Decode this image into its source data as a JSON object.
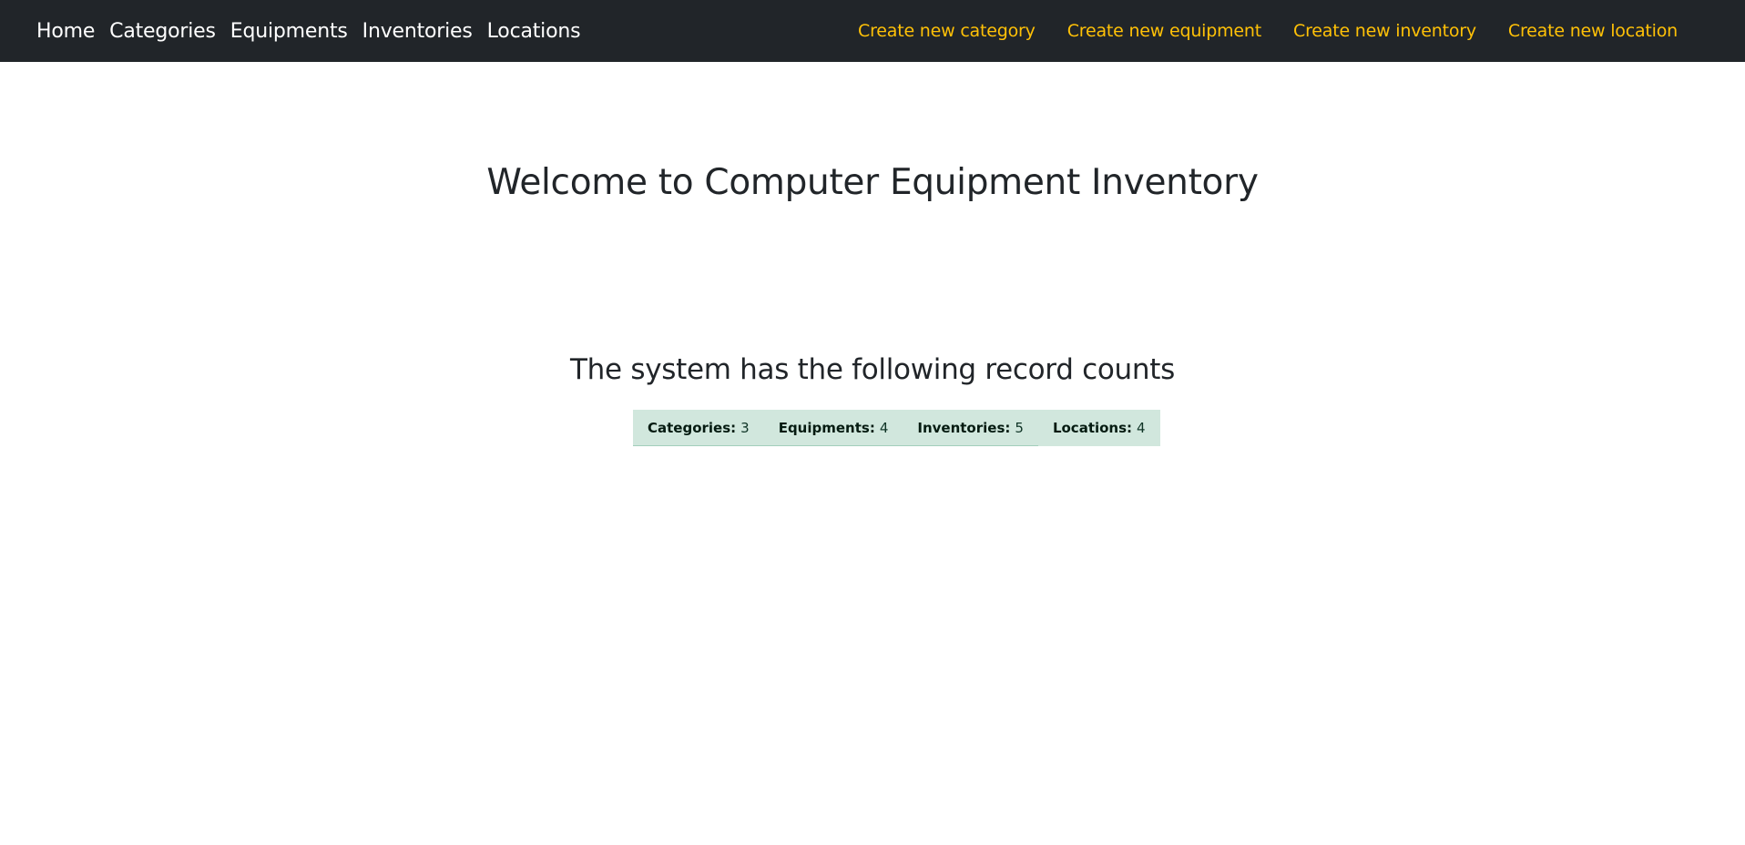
{
  "navbar": {
    "left_links": [
      "Home",
      "Categories",
      "Equipments",
      "Inventories",
      "Locations"
    ],
    "right_links": [
      "Create new category",
      "Create new equipment",
      "Create new inventory",
      "Create new location"
    ],
    "colors": {
      "background": "#212529",
      "left_link": "#ffffff",
      "right_link": "#ffc107"
    }
  },
  "main": {
    "title": "Welcome to Computer Equipment Inventory",
    "subtitle": "The system has the following record counts",
    "counts": [
      {
        "label": "Categories:",
        "value": "3"
      },
      {
        "label": "Equipments:",
        "value": "4"
      },
      {
        "label": "Inventories:",
        "value": "5"
      },
      {
        "label": "Locations:",
        "value": "4"
      }
    ],
    "count_bg_color": "#d1e7dd"
  }
}
